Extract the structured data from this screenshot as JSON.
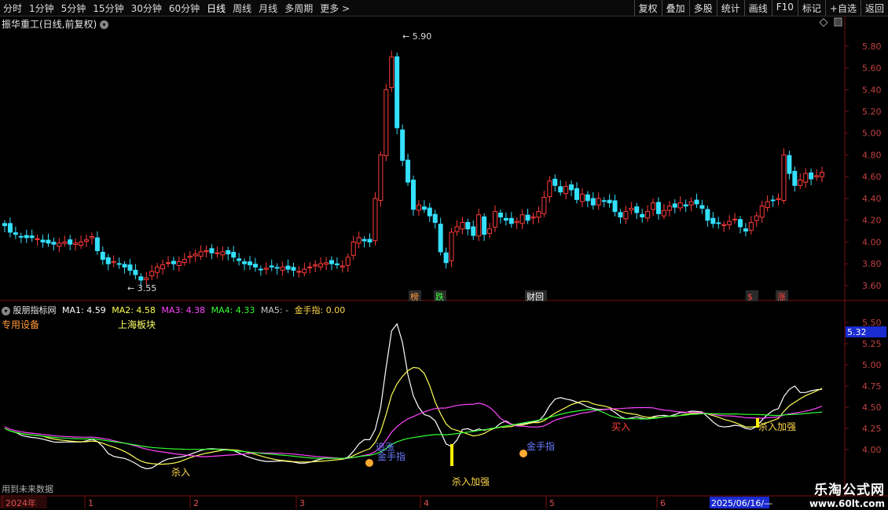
{
  "toolbar": {
    "periods": [
      "分时",
      "1分钟",
      "5分钟",
      "15分钟",
      "30分钟",
      "60分钟",
      "日线",
      "周线",
      "月线",
      "多周期",
      "更多 >"
    ],
    "active_period": "日线",
    "actions": [
      "复权",
      "叠加",
      "多股",
      "统计",
      "画线",
      "F10",
      "标记",
      "+自选",
      "返回"
    ]
  },
  "stock": {
    "title": "振华重工(日线,前复权)",
    "high_label": "5.90",
    "low_label": "3.55"
  },
  "price_axis": {
    "ticks": [
      "5.80",
      "5.60",
      "5.40",
      "5.20",
      "5.00",
      "4.80",
      "4.60",
      "4.40",
      "4.20",
      "4.00",
      "3.80",
      "3.60"
    ]
  },
  "event_markers": [
    {
      "text": "榜",
      "color": "#ff9a3c"
    },
    {
      "text": "跌",
      "color": "#3cff3c"
    },
    {
      "text": "财回",
      "color": "#ffffff"
    },
    {
      "text": "$",
      "color": "#ff4040"
    },
    {
      "text": "涨",
      "color": "#ff4040"
    }
  ],
  "indicator": {
    "name": "股朋指标网",
    "ma1": "MA1: 4.59",
    "ma2": "MA2: 4.58",
    "ma3": "MA3: 4.38",
    "ma4": "MA4: 4.33",
    "ma5": "MA5: -",
    "jsz": "金手指: 0.00",
    "label_left": "专用设备",
    "label_block": "上海板块",
    "future_note": "用到未来数据",
    "ticks": [
      "5.50",
      "5.25",
      "5.00",
      "4.75",
      "4.50",
      "4.25",
      "4.00"
    ],
    "current_value": "5.32",
    "annotations": [
      {
        "text": "杀入",
        "color": "#ffd84a"
      },
      {
        "text": "追涨",
        "color": "#6a7bff"
      },
      {
        "text": "金手指",
        "color": "#6a7bff"
      },
      {
        "text": "杀入加强",
        "color": "#ffd84a"
      },
      {
        "text": "金手指",
        "color": "#6a7bff"
      },
      {
        "text": "买入",
        "color": "#ff4040"
      },
      {
        "text": "杀入加强",
        "color": "#ffd84a"
      }
    ]
  },
  "time_axis": {
    "labels": [
      "2024年",
      "1",
      "2",
      "3",
      "4",
      "5",
      "6"
    ],
    "current_date": "2025/06/16/—"
  },
  "watermark": {
    "line1": "乐淘公式网",
    "line2": "www.60lt.com"
  },
  "colors": {
    "up": "#ff3b3b",
    "down": "#33e0ff",
    "ma1": "#ffffff",
    "ma2": "#ffff55",
    "ma3": "#ff44ff",
    "ma4": "#33ff33",
    "grid": "#7a1010"
  },
  "chart_data": {
    "type": "candlestick",
    "closes": [
      4.15,
      4.09,
      4.07,
      4.05,
      4.04,
      4.04,
      4.03,
      4.0,
      3.99,
      3.98,
      3.99,
      4.0,
      3.98,
      3.99,
      4.0,
      4.02,
      4.05,
      3.92,
      3.84,
      3.8,
      3.82,
      3.8,
      3.77,
      3.74,
      3.7,
      3.65,
      3.67,
      3.73,
      3.77,
      3.79,
      3.81,
      3.8,
      3.82,
      3.84,
      3.87,
      3.89,
      3.91,
      3.92,
      3.9,
      3.9,
      3.91,
      3.89,
      3.86,
      3.83,
      3.8,
      3.79,
      3.77,
      3.75,
      3.76,
      3.77,
      3.76,
      3.77,
      3.75,
      3.74,
      3.73,
      3.75,
      3.77,
      3.79,
      3.8,
      3.81,
      3.8,
      3.79,
      3.78,
      3.86,
      4.0,
      4.04,
      4.01,
      4.0,
      4.4,
      4.8,
      5.4,
      5.7,
      5.05,
      4.75,
      4.55,
      4.3,
      4.34,
      4.3,
      4.24,
      4.18,
      3.91,
      3.81,
      4.09,
      4.14,
      4.18,
      4.12,
      4.06,
      4.25,
      4.07,
      4.12,
      4.28,
      4.23,
      4.2,
      4.17,
      4.19,
      4.25,
      4.2,
      4.23,
      4.28,
      4.41,
      4.56,
      4.52,
      4.46,
      4.51,
      4.48,
      4.39,
      4.44,
      4.38,
      4.34,
      4.4,
      4.38,
      4.36,
      4.28,
      4.23,
      4.28,
      4.31,
      4.27,
      4.23,
      4.28,
      4.36,
      4.26,
      4.29,
      4.33,
      4.32,
      4.36,
      4.33,
      4.37,
      4.35,
      4.31,
      4.2,
      4.17,
      4.17,
      4.16,
      4.19,
      4.21,
      4.14,
      4.1,
      4.18,
      4.24,
      4.33,
      4.37,
      4.38,
      4.4,
      4.8,
      4.63,
      4.52,
      4.57,
      4.63,
      4.58,
      4.61,
      4.64
    ]
  }
}
